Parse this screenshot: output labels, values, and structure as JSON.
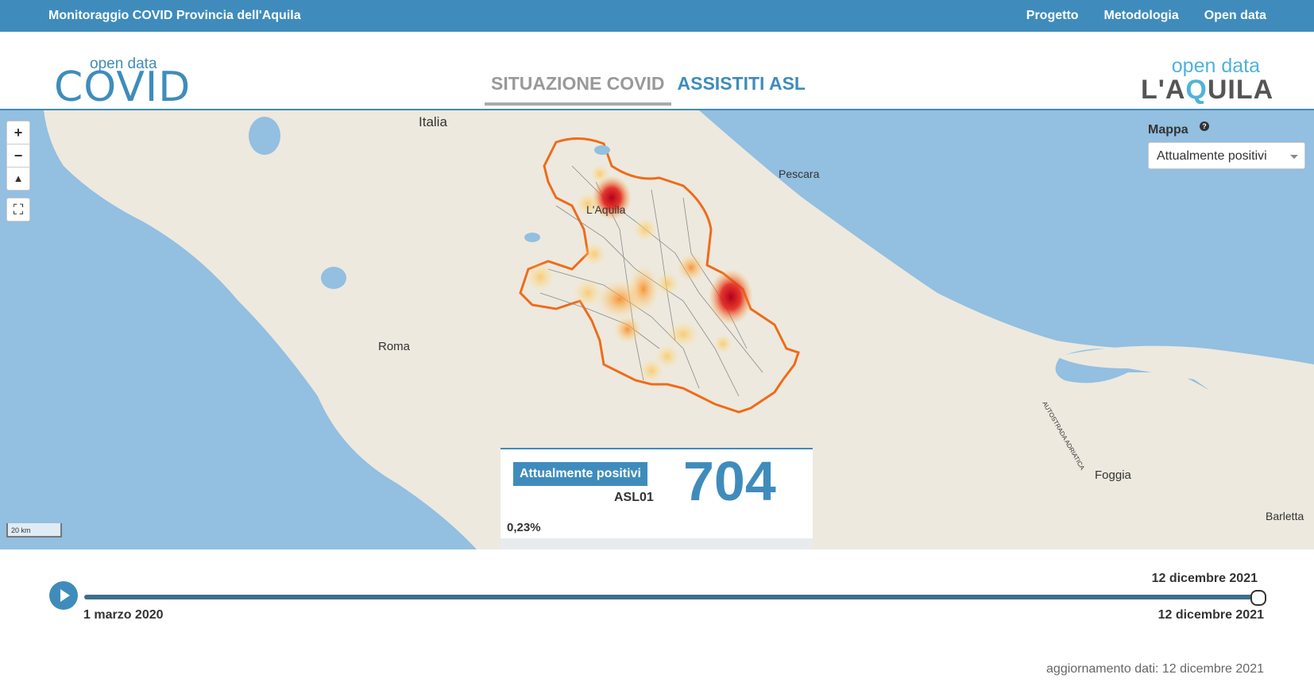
{
  "topbar": {
    "title": "Monitoraggio COVID Provincia dell'Aquila",
    "nav": [
      "Progetto",
      "Metodologia",
      "Open data"
    ]
  },
  "logos": {
    "left_top": "open data",
    "left_main": "COVID",
    "right_top": "open data",
    "right_main_a": "L'A",
    "right_main_q": "Q",
    "right_main_b": "UILA"
  },
  "tabs": [
    {
      "label": "SITUAZIONE COVID",
      "active": true
    },
    {
      "label": "ASSISTITI ASL",
      "active": false
    }
  ],
  "map": {
    "labels": {
      "italia": "Italia",
      "pescara": "Pescara",
      "laquila": "L'Aquila",
      "roma": "Roma",
      "foggia": "Foggia",
      "barletta": "Barletta",
      "autostrada": "AUTOSTRADA ADRIATICA"
    },
    "scale": "20 km",
    "zoom_in": "+",
    "zoom_out": "−",
    "reset": "▲",
    "fullscreen": "⛶",
    "control": {
      "label": "Mappa",
      "help": "?",
      "selected": "Attualmente positivi"
    },
    "colors": {
      "sea": "#93bfe0",
      "land": "#ede9df",
      "border": "#ef6c1a",
      "heat_hot": "#b3001b",
      "heat_warm": "#fbb33b"
    }
  },
  "infobox": {
    "badge": "Attualmente positivi",
    "area": "ASL01",
    "value": "704",
    "percent": "0,23%"
  },
  "timeline": {
    "current": "12 dicembre 2021",
    "start": "1 marzo 2020",
    "end": "12 dicembre 2021",
    "progress": 1.0
  },
  "updated": "aggiornamento dati: 12 dicembre 2021"
}
